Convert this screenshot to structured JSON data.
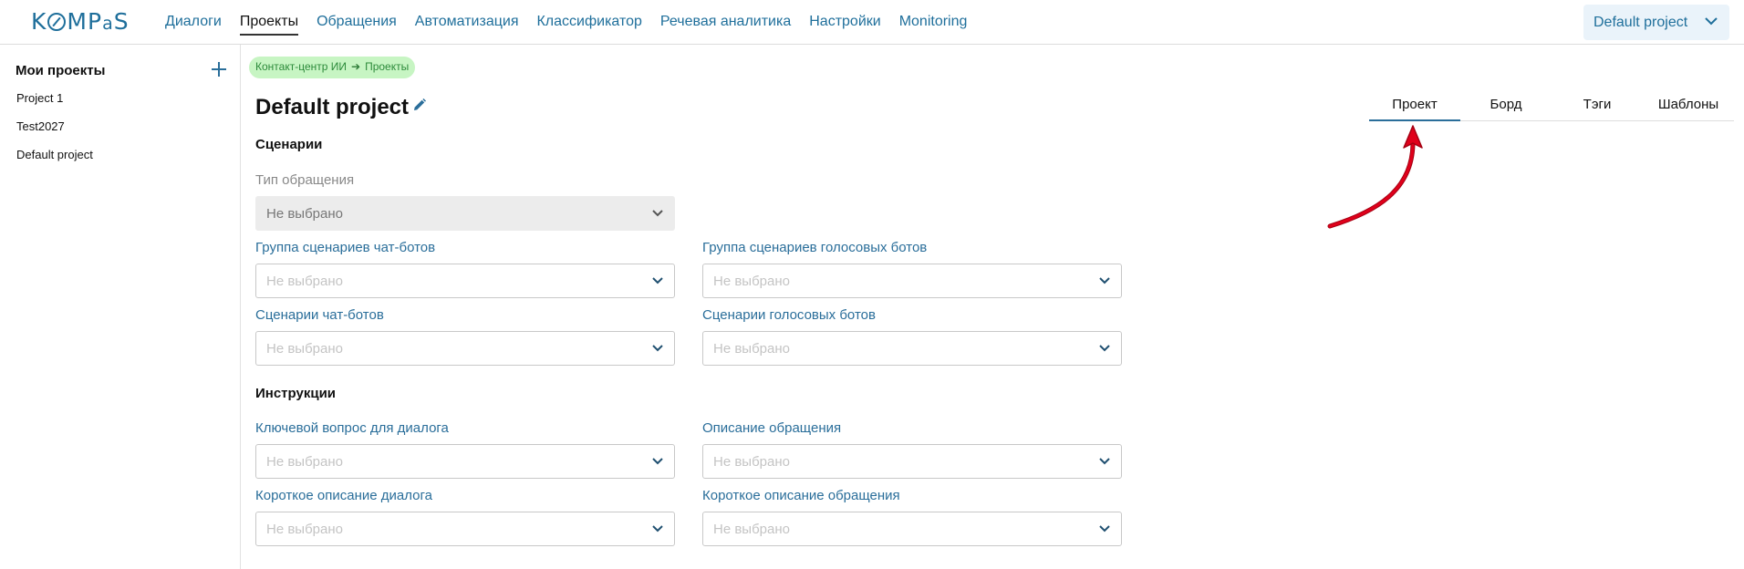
{
  "header": {
    "logo_text": "KOMPaS",
    "nav": [
      {
        "label": "Диалоги",
        "active": false
      },
      {
        "label": "Проекты",
        "active": true
      },
      {
        "label": "Обращения",
        "active": false
      },
      {
        "label": "Автоматизация",
        "active": false
      },
      {
        "label": "Классификатор",
        "active": false
      },
      {
        "label": "Речевая аналитика",
        "active": false
      },
      {
        "label": "Настройки",
        "active": false
      },
      {
        "label": "Monitoring",
        "active": false
      }
    ],
    "project_selector": "Default project"
  },
  "sidebar": {
    "title": "Мои проекты",
    "items": [
      "Project 1",
      "Test2027",
      "Default project"
    ]
  },
  "breadcrumb": {
    "root": "Контакт-центр ИИ",
    "current": "Проекты"
  },
  "page": {
    "title": "Default project"
  },
  "tabs": [
    {
      "label": "Проект",
      "active": true
    },
    {
      "label": "Борд",
      "active": false
    },
    {
      "label": "Тэги",
      "active": false
    },
    {
      "label": "Шаблоны",
      "active": false
    }
  ],
  "sections": {
    "scenarios": {
      "title": "Сценарии",
      "request_type": {
        "label": "Тип обращения",
        "value": "Не выбрано",
        "disabled": true
      },
      "chatbot_group": {
        "label": "Группа сценариев чат-ботов",
        "value": "Не выбрано"
      },
      "voicebot_group": {
        "label": "Группа сценариев голосовых ботов",
        "value": "Не выбрано"
      },
      "chatbot_scenarios": {
        "label": "Сценарии чат-ботов",
        "value": "Не выбрано"
      },
      "voicebot_scenarios": {
        "label": "Сценарии голосовых ботов",
        "value": "Не выбрано"
      }
    },
    "instructions": {
      "title": "Инструкции",
      "key_question": {
        "label": "Ключевой вопрос для диалога",
        "value": "Не выбрано"
      },
      "request_description": {
        "label": "Описание обращения",
        "value": "Не выбрано"
      },
      "short_dialog_description": {
        "label": "Короткое описание диалога",
        "value": "Не выбрано"
      },
      "short_request_description": {
        "label": "Короткое описание обращения",
        "value": "Не выбрано"
      }
    }
  },
  "colors": {
    "accent": "#1f6f9b",
    "breadcrumb_bg": "#c7f5c3",
    "annotation_arrow": "#e0001b"
  }
}
